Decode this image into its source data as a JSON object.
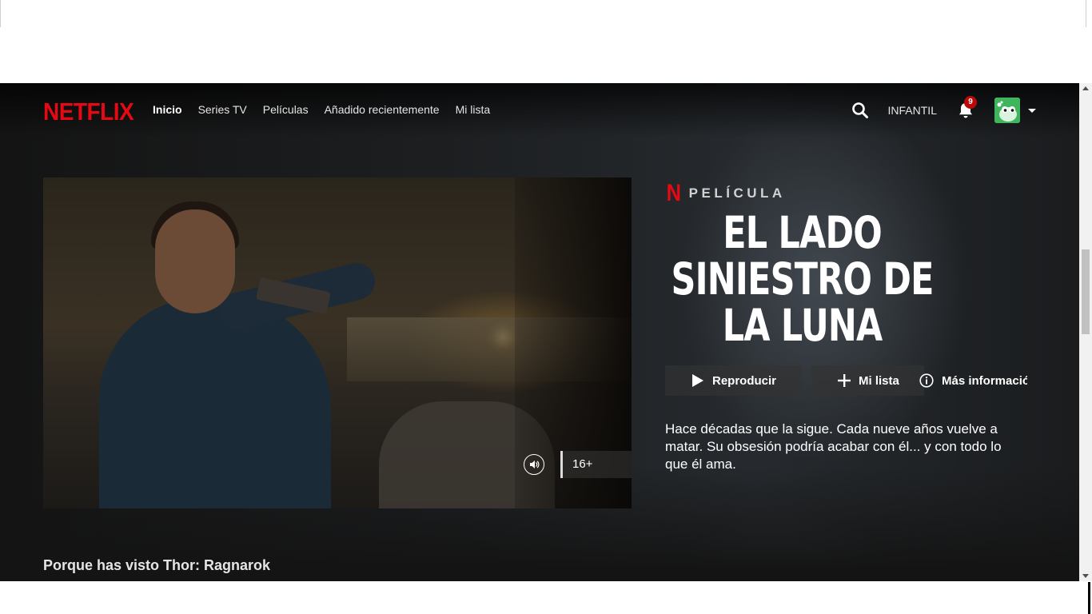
{
  "nav": {
    "logo": "NETFLIX",
    "links": [
      "Inicio",
      "Series TV",
      "Películas",
      "Añadido recientemente",
      "Mi lista"
    ],
    "active_link": "Inicio",
    "kids_label": "INFANTIL",
    "notification_count": "9"
  },
  "hero": {
    "type_label": "PELÍCULA",
    "title_line1": "EL LADO",
    "title_line2": "SINIESTRO DE",
    "title_line3": "LA LUNA",
    "play_label": "Reproducir",
    "mylist_label": "Mi lista",
    "info_label": "Más información",
    "synopsis": "Hace décadas que la sigue. Cada nueve años vuelve a matar. Su obsesión podría acabar con él... y con todo lo que él ama.",
    "rating": "16+"
  },
  "row": {
    "title": "Porque has visto Thor: Ragnarok"
  },
  "colors": {
    "brand": "#e50914",
    "background": "#141414",
    "badge": "#b9090b",
    "avatar": "#3fb55d"
  },
  "icons": [
    "search-icon",
    "bell-icon",
    "avatar",
    "caret-down-icon",
    "play-icon",
    "plus-icon",
    "info-icon",
    "volume-icon"
  ]
}
